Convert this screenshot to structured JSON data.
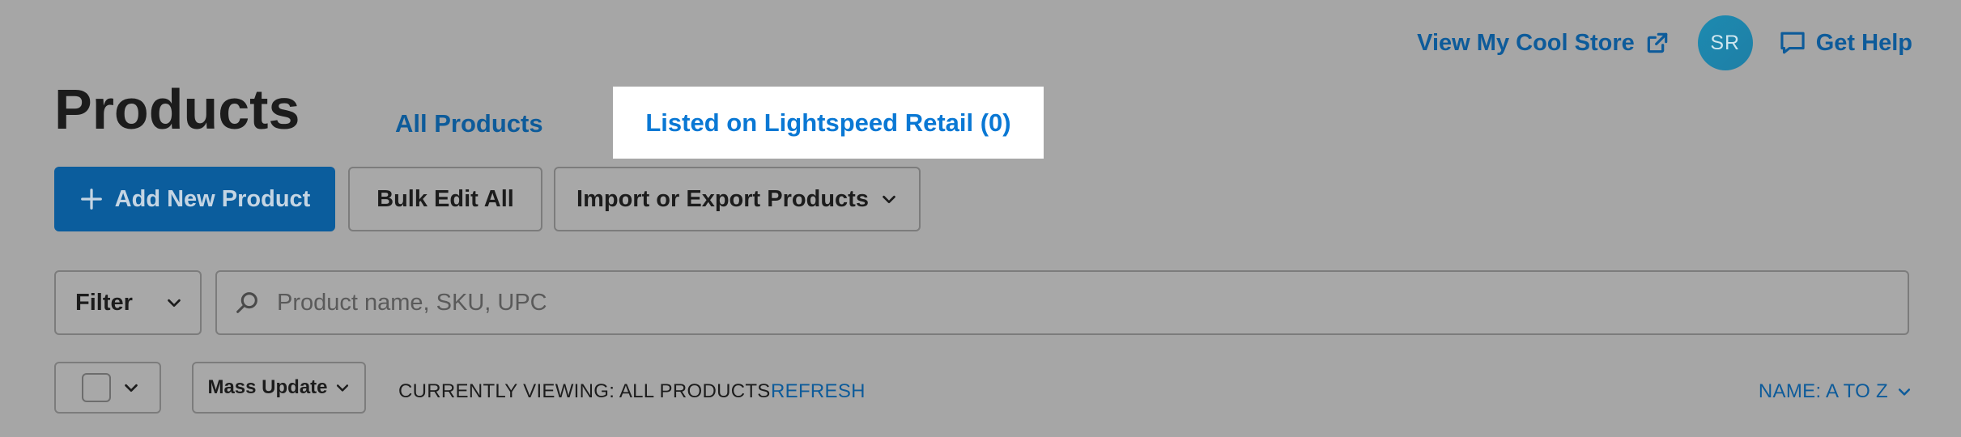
{
  "header": {
    "view_store_label": "View My Cool Store",
    "avatar_initials": "SR",
    "get_help_label": "Get Help"
  },
  "page": {
    "title": "Products"
  },
  "tabs": [
    {
      "label": "All Products",
      "active": false
    },
    {
      "label": "Listed on Lightspeed Retail (0)",
      "active": true
    }
  ],
  "actions": {
    "add_new_label": "Add New Product",
    "bulk_edit_label": "Bulk Edit All",
    "import_export_label": "Import or Export Products"
  },
  "filter": {
    "label": "Filter"
  },
  "search": {
    "placeholder": "Product name, SKU, UPC",
    "value": ""
  },
  "list_controls": {
    "mass_update_label": "Mass Update",
    "currently_viewing": "CURRENTLY VIEWING: ALL PRODUCTS",
    "refresh_label": "REFRESH",
    "sort_label": "NAME: A TO Z"
  },
  "icons": {
    "external_link": "external-link-icon",
    "help": "chat-bubble-icon",
    "plus": "plus-icon",
    "chevron": "chevron-down-icon",
    "search": "search-icon"
  },
  "colors": {
    "link": "#0d5b9a",
    "active_tab": "#0a78d4",
    "primary_button": "#0b5d9d",
    "avatar": "#1d8ab0",
    "overlay_background": "#a6a6a6"
  }
}
